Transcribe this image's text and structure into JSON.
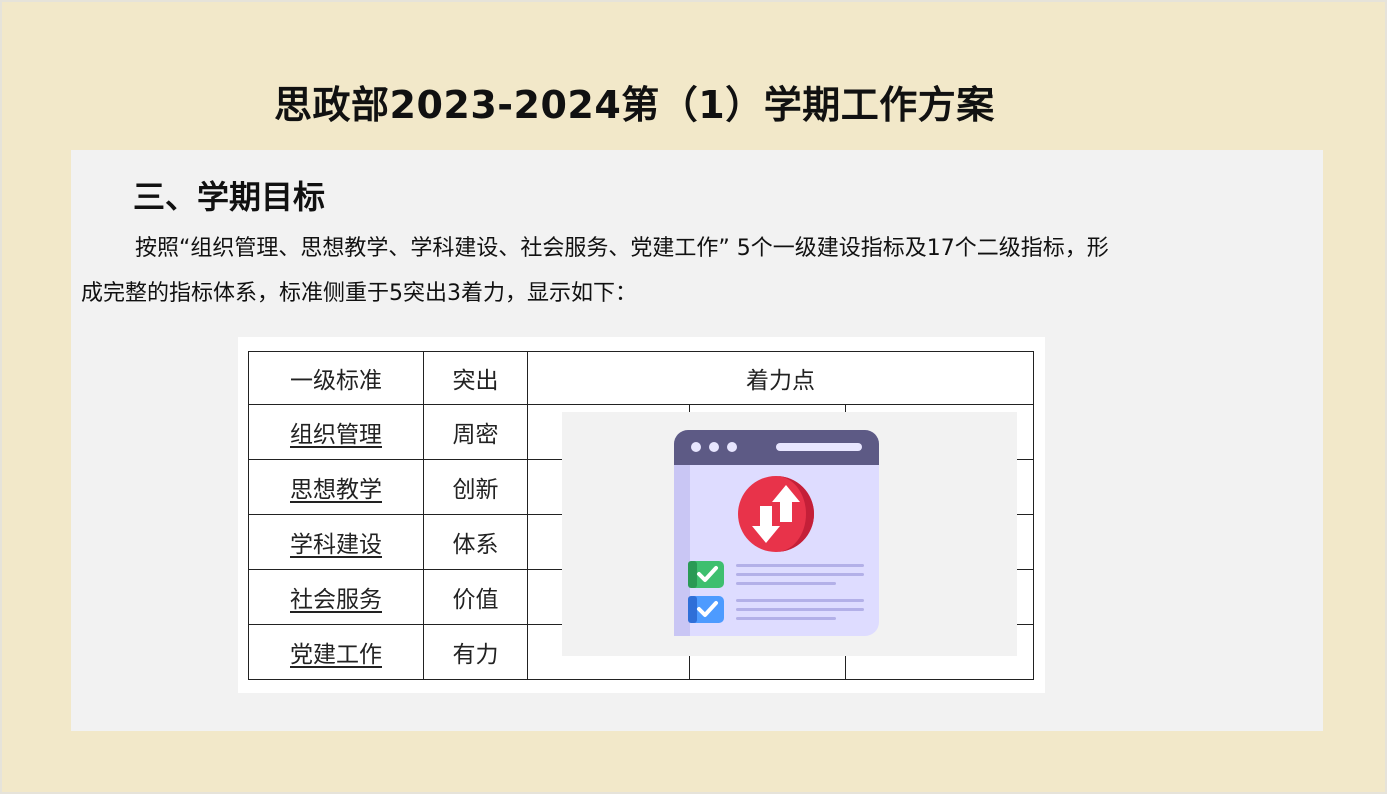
{
  "slide": {
    "title": "思政部2023-2024第（1）学期工作方案",
    "section_heading": "三、学期目标",
    "paragraph_line1": "按照“组织管理、思想教学、学科建设、社会服务、党建工作” 5个一级建设指标及17个二级指标，形",
    "paragraph_line2": "成完整的指标体系，标准侧重于5突出3着力，显示如下："
  },
  "table": {
    "headers": [
      "一级标准",
      "突出",
      "着力点"
    ],
    "rows": [
      {
        "standard": "组织管理",
        "highlight": "周密",
        "focus": [
          "",
          "",
          ""
        ]
      },
      {
        "standard": "思想教学",
        "highlight": "创新",
        "focus": [
          "",
          "",
          ""
        ]
      },
      {
        "standard": "学科建设",
        "highlight": "体系",
        "focus": [
          "",
          "",
          ""
        ]
      },
      {
        "standard": "社会服务",
        "highlight": "价值",
        "focus": [
          "",
          "",
          ""
        ]
      },
      {
        "standard": "党建工作",
        "highlight": "有力",
        "focus": [
          "",
          "",
          ""
        ]
      }
    ]
  },
  "overlay_icon": {
    "name": "browser-sync-icon",
    "colors": {
      "window_bar": "#5d5a85",
      "window_body": "#dedcff",
      "circle": "#e8334a",
      "check_green": "#3ebf6f",
      "check_blue": "#4d9bff",
      "lines": "#b3b0e8"
    }
  }
}
